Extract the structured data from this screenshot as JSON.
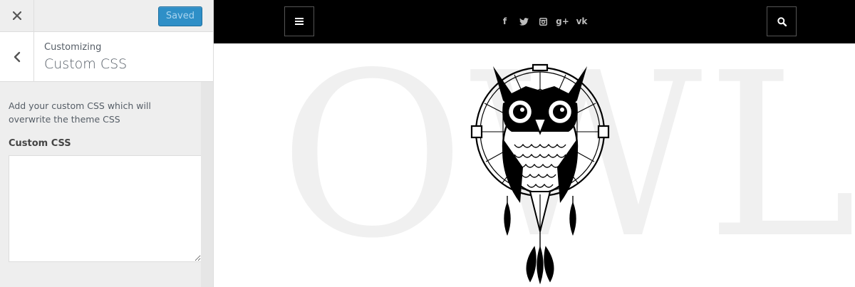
{
  "sidebar": {
    "saved_label": "Saved",
    "section_kicker": "Customizing",
    "section_title": "Custom CSS",
    "description": "Add your custom CSS which will overwrite the theme CSS",
    "field_label": "Custom CSS",
    "textarea_value": "",
    "colors": {
      "saved_button": "#2e8fc7"
    }
  },
  "preview": {
    "background_word": "OWL",
    "social_links": [
      {
        "icon": "facebook-icon",
        "glyph": "f"
      },
      {
        "icon": "twitter-icon",
        "glyph": ""
      },
      {
        "icon": "instagram-icon",
        "glyph": ""
      },
      {
        "icon": "google-plus-icon",
        "glyph": "g+"
      },
      {
        "icon": "vk-icon",
        "glyph": "vk"
      }
    ],
    "logo_icon": "owl-dreamcatcher-logo",
    "topbar_color": "#000000"
  }
}
